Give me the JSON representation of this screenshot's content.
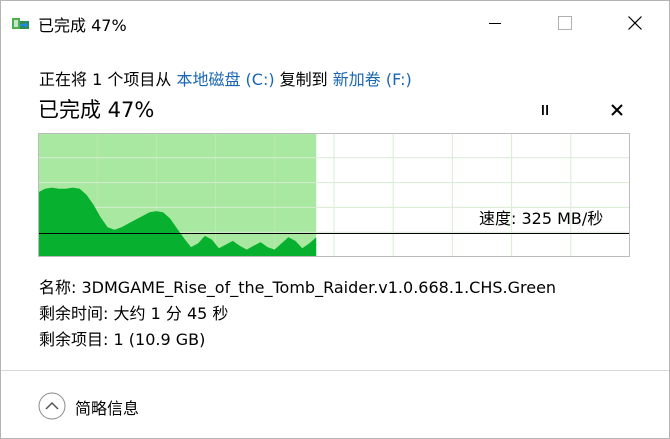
{
  "titlebar": {
    "title": "已完成 47%",
    "icon": "copy-folder-icon",
    "buttons": {
      "minimize": "minimize-icon",
      "maximize": "maximize-icon",
      "close": "close-icon"
    }
  },
  "operation": {
    "prefix": "正在将 1 个项目从 ",
    "source": "本地磁盘 (C:)",
    "middle": " 复制到 ",
    "destination": "新加卷 (F:)"
  },
  "status": {
    "text": "已完成 47%",
    "pause_icon": "pause-icon",
    "cancel_icon": "close-icon"
  },
  "progress": {
    "percent": 47,
    "speed_label": "速度: 325 MB/秒",
    "speed_series": [
      0.52,
      0.55,
      0.56,
      0.55,
      0.55,
      0.56,
      0.55,
      0.5,
      0.42,
      0.32,
      0.24,
      0.22,
      0.24,
      0.27,
      0.3,
      0.33,
      0.36,
      0.37,
      0.36,
      0.31,
      0.23,
      0.15,
      0.08,
      0.11,
      0.17,
      0.14,
      0.07,
      0.1,
      0.13,
      0.09,
      0.06,
      0.09,
      0.12,
      0.08,
      0.06,
      0.11,
      0.16,
      0.13,
      0.07,
      0.11,
      0.16
    ],
    "current_speed": 0.19,
    "colors": {
      "fill": "#a9e8a0",
      "area": "#07b02f",
      "grid": "#d7ecd3",
      "border": "#bcbcbc",
      "line": "#000000"
    }
  },
  "details": {
    "name_label": "名称:",
    "name_value": "3DMGAME_Rise_of_the_Tomb_Raider.v1.0.668.1.CHS.Green",
    "time_label": "剩余时间:",
    "time_value": "大约 1 分 45 秒",
    "items_label": "剩余项目:",
    "items_value": "1 (10.9 GB)"
  },
  "footer": {
    "toggle_label": "简略信息",
    "toggle_icon": "chevron-up-icon"
  }
}
